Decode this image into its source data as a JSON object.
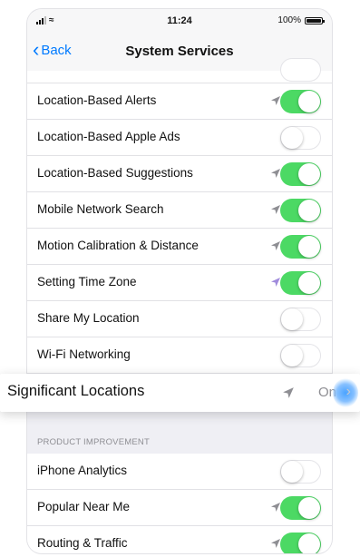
{
  "status_bar": {
    "time": "11:24",
    "battery": "100%",
    "wifi_icon": "wifi-icon",
    "signal_icon": "signal-icon"
  },
  "nav": {
    "back_label": "Back",
    "title": "System Services"
  },
  "rows": [
    {
      "label": "Location-Based Alerts",
      "arrow": true,
      "arrow_color": "#8e8e93",
      "on": true
    },
    {
      "label": "Location-Based Apple Ads",
      "arrow": false,
      "on": false
    },
    {
      "label": "Location-Based Suggestions",
      "arrow": true,
      "arrow_color": "#8e8e93",
      "on": true
    },
    {
      "label": "Mobile Network Search",
      "arrow": true,
      "arrow_color": "#8e8e93",
      "on": true
    },
    {
      "label": "Motion Calibration & Distance",
      "arrow": true,
      "arrow_color": "#8e8e93",
      "on": true
    },
    {
      "label": "Setting Time Zone",
      "arrow": true,
      "arrow_color": "#a08bdc",
      "on": true
    },
    {
      "label": "Share My Location",
      "arrow": false,
      "on": false
    },
    {
      "label": "Wi-Fi Networking",
      "arrow": false,
      "on": false
    }
  ],
  "highlight": {
    "label": "Significant Locations",
    "value": "On",
    "arrow_icon": "location-arrow-icon"
  },
  "product_section": {
    "header": "PRODUCT IMPROVEMENT",
    "rows": [
      {
        "label": "iPhone Analytics",
        "arrow": false,
        "on": false
      },
      {
        "label": "Popular Near Me",
        "arrow": true,
        "arrow_color": "#8e8e93",
        "on": true
      },
      {
        "label": "Routing & Traffic",
        "arrow": true,
        "arrow_color": "#8e8e93",
        "on": true
      }
    ]
  },
  "colors": {
    "accent": "#007aff",
    "toggle_on": "#4cd964",
    "background": "#efeff4"
  }
}
